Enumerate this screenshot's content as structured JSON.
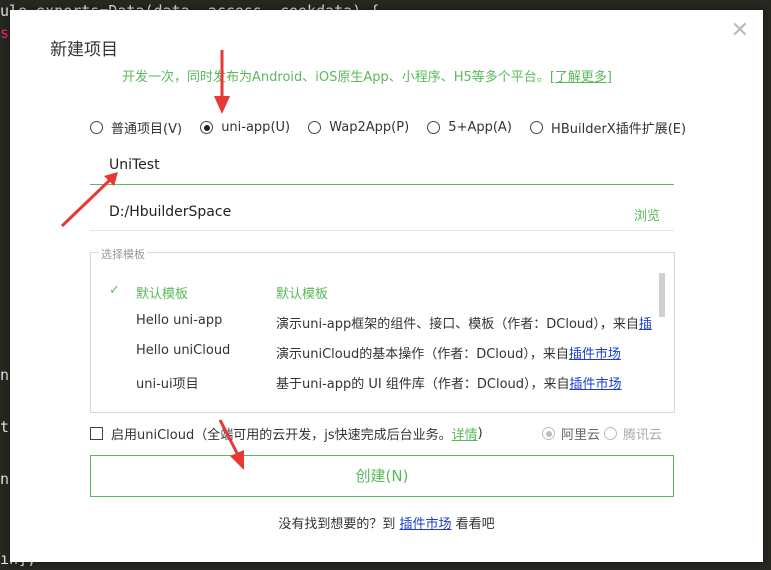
{
  "background_code": {
    "line1": "ule.exports=Data(data, access, cookdata) {",
    "line2": "s",
    "line3": "nn",
    "line4": "te",
    "line5": "n",
    "line6": "ın],"
  },
  "dialog": {
    "close_glyph": "✕",
    "title": "新建项目",
    "subtitle": "开发一次，同时发布为Android、iOS原生App、小程序、H5等多个平台。",
    "learn_more": "[了解更多]",
    "project_types": [
      {
        "label": "普通项目(V)",
        "selected": false
      },
      {
        "label": "uni-app(U)",
        "selected": true
      },
      {
        "label": "Wap2App(P)",
        "selected": false
      },
      {
        "label": "5+App(A)",
        "selected": false
      },
      {
        "label": "HBuilderX插件扩展(E)",
        "selected": false
      }
    ],
    "project_name": "UniTest",
    "project_path": "D:/HbuilderSpace",
    "browse_label": "浏览",
    "templates_legend": "选择模板",
    "templates": [
      {
        "name": "默认模板",
        "desc": "默认模板",
        "selected": true
      },
      {
        "name": "Hello uni-app",
        "desc": "演示uni-app框架的组件、接口、模板（作者：DCloud），来自",
        "link": "插"
      },
      {
        "name": "Hello uniCloud",
        "desc": "演示uniCloud的基本操作（作者：DCloud），来自",
        "link": "插件市场"
      },
      {
        "name": "uni-ui项目",
        "desc": "基于uni-app的 UI 组件库（作者：DCloud），来自",
        "link": "插件市场"
      }
    ],
    "unicloud_label": "启用uniCloud（全端可用的云开发，js快速完成后台业务。",
    "unicloud_details": "详情",
    "unicloud_close": ")",
    "providers": [
      "阿里云",
      "腾讯云"
    ],
    "create_label": "创建(N)",
    "footer_text": "没有找到想要的？到",
    "footer_link": "插件市场",
    "footer_suffix": "看看吧"
  },
  "colors": {
    "accent": "#5bb85b",
    "link": "#1a3fd0",
    "arrow": "#e53935"
  }
}
